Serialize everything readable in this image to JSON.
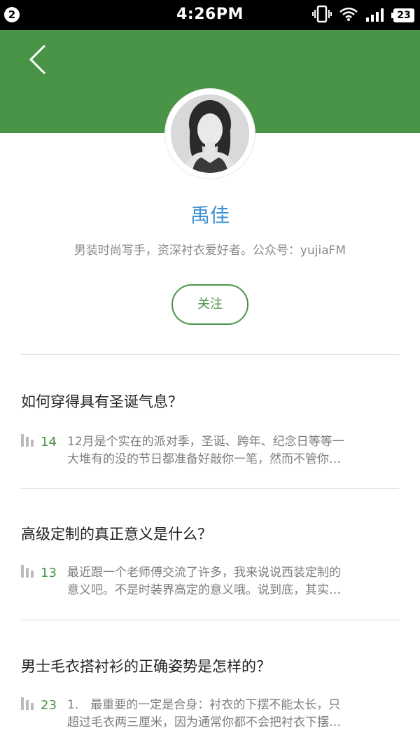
{
  "status_bar": {
    "notification_count": "2",
    "time": "4:26PM",
    "battery": "23"
  },
  "profile": {
    "name": "禹佳",
    "bio": "男装时尚写手，资深衬衣爱好者。公众号：yujiaFM",
    "follow_label": "关注"
  },
  "articles": [
    {
      "title": "如何穿得具有圣诞气息？",
      "count": "14",
      "summary_lines": [
        "12月是个实在的派对季，圣诞、跨年、纪念日等等一",
        "大堆有的没的节日都准备好敲你一笔，然而不管你…"
      ]
    },
    {
      "title": "高级定制的真正意义是什么？",
      "count": "13",
      "summary_lines": [
        "最近跟一个老师傅交流了许多，我来说说西装定制的",
        "意义吧。不是时装界高定的意义哦。说到底，其实…"
      ]
    },
    {
      "title": "男士毛衣搭衬衫的正确姿势是怎样的？",
      "count": "23",
      "summary_lines": [
        "1.　最重要的一定是合身：衬衣的下摆不能太长，只",
        "超过毛衣两三厘米，因为通常你都不会把衬衣下摆…"
      ]
    }
  ],
  "icons": {
    "back": "chevron-left-icon",
    "stats": "bar-chart-icon",
    "vibrate": "vibrate-icon",
    "wifi": "wifi-icon",
    "signal": "signal-icon"
  },
  "colors": {
    "brand_green": "#4a9448",
    "name_blue": "#3a8fd6"
  }
}
